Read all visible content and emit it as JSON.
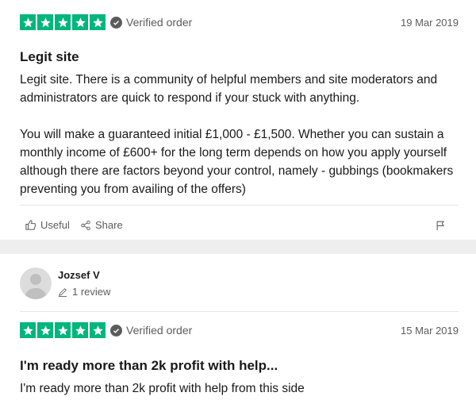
{
  "reviews": [
    {
      "rating": 5,
      "verified_label": "Verified order",
      "date": "19 Mar 2019",
      "title": "Legit site",
      "paragraphs": [
        "Legit site. There is a community of helpful members and site moderators and administrators are quick to respond if your stuck with anything.",
        "You will make a guaranteed initial £1,000 - £1,500. Whether you can sustain a monthly income of £600+ for the long term depends on how you apply yourself although there are factors beyond your control, namely - gubbings (bookmakers preventing you from availing of the offers)"
      ],
      "actions": {
        "useful": "Useful",
        "share": "Share"
      }
    },
    {
      "reviewer": {
        "name": "Jozsef V",
        "review_count": "1 review"
      },
      "rating": 5,
      "verified_label": "Verified order",
      "date": "15 Mar 2019",
      "title": "I'm ready more than 2k profit with help...",
      "paragraphs": [
        "I'm ready more than 2k profit with help from this side"
      ]
    }
  ],
  "colors": {
    "star_green": "#00b67a",
    "muted_text": "#5c5c5c",
    "page_bg": "#eeeeee"
  },
  "icons": [
    "star-icon",
    "check-circle-icon",
    "thumbs-up-icon",
    "share-icon",
    "flag-icon",
    "pencil-icon",
    "avatar-placeholder-icon"
  ]
}
